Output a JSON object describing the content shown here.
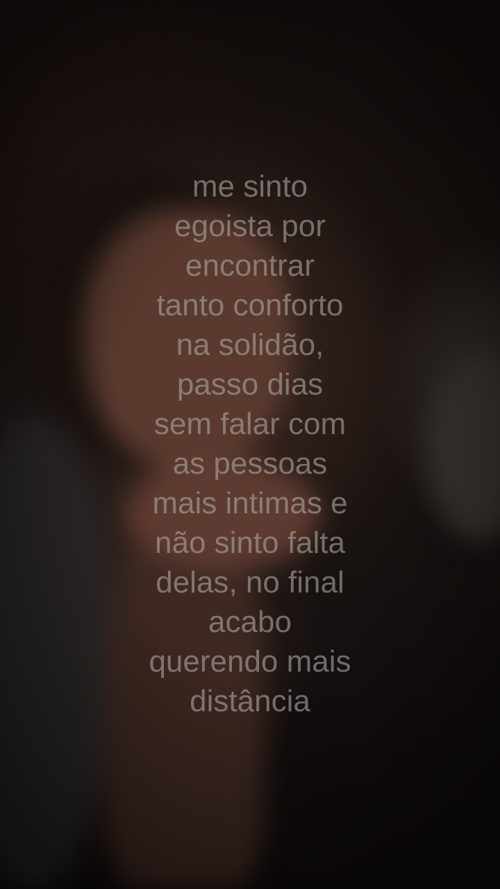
{
  "caption": {
    "lines": [
      "me sinto",
      "egoista por",
      "encontrar",
      "tanto conforto",
      "na solidão,",
      "passo dias",
      "sem falar com",
      "as pessoas",
      "mais intimas e",
      "não sinto falta",
      "delas, no final",
      "acabo",
      "querendo mais",
      "distância"
    ],
    "color": "#aaa4a0"
  }
}
